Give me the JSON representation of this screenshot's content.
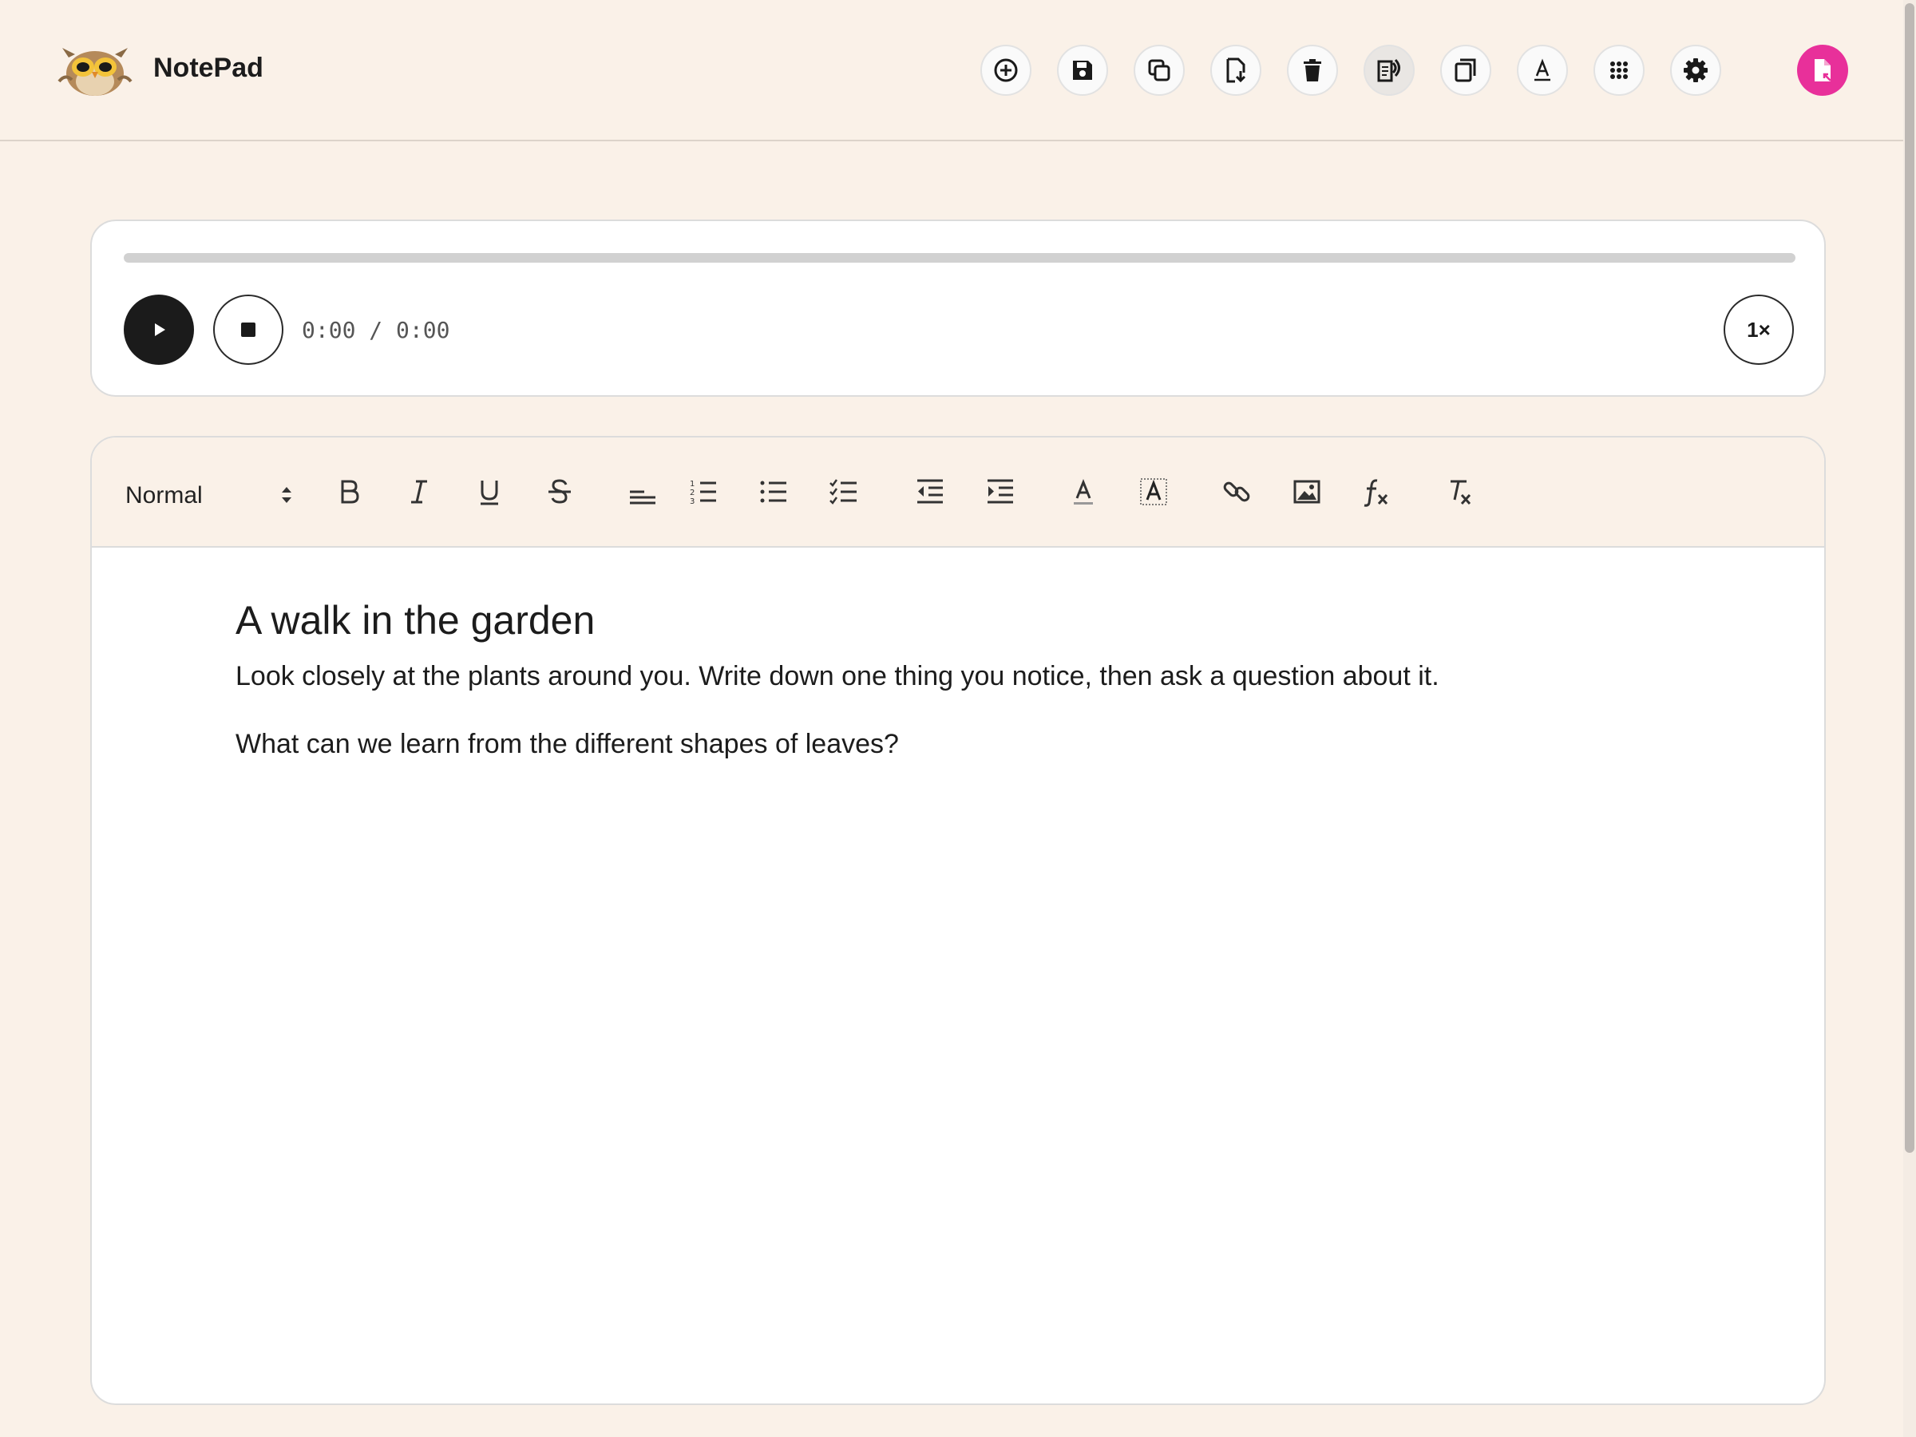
{
  "app": {
    "title": "NotePad"
  },
  "toolbar": {
    "buttons": [
      {
        "name": "new",
        "icon": "plus-circle-icon"
      },
      {
        "name": "save",
        "icon": "floppy-disk-icon"
      },
      {
        "name": "duplicate",
        "icon": "copy-icon"
      },
      {
        "name": "download",
        "icon": "file-download-icon"
      },
      {
        "name": "delete",
        "icon": "trash-icon"
      },
      {
        "name": "read-aloud",
        "icon": "speaker-doc-icon",
        "active": true
      },
      {
        "name": "copy-text",
        "icon": "copy-pages-icon"
      },
      {
        "name": "font",
        "icon": "font-a-icon"
      },
      {
        "name": "apps",
        "icon": "grid-dots-icon"
      },
      {
        "name": "settings",
        "icon": "gear-icon"
      }
    ],
    "profile_color": "#e8309a"
  },
  "player": {
    "time": "0:00 / 0:00",
    "speed": "1×",
    "progress": 0
  },
  "editor": {
    "format": "Normal",
    "heading": "A walk in the garden",
    "paragraphs": [
      "Look closely at the plants around you. Write down one thing you notice, then ask a question about it.",
      "What can we learn from the different shapes of leaves?"
    ]
  },
  "colors": {
    "background": "#faf1e8",
    "accent": "#e8309a"
  }
}
